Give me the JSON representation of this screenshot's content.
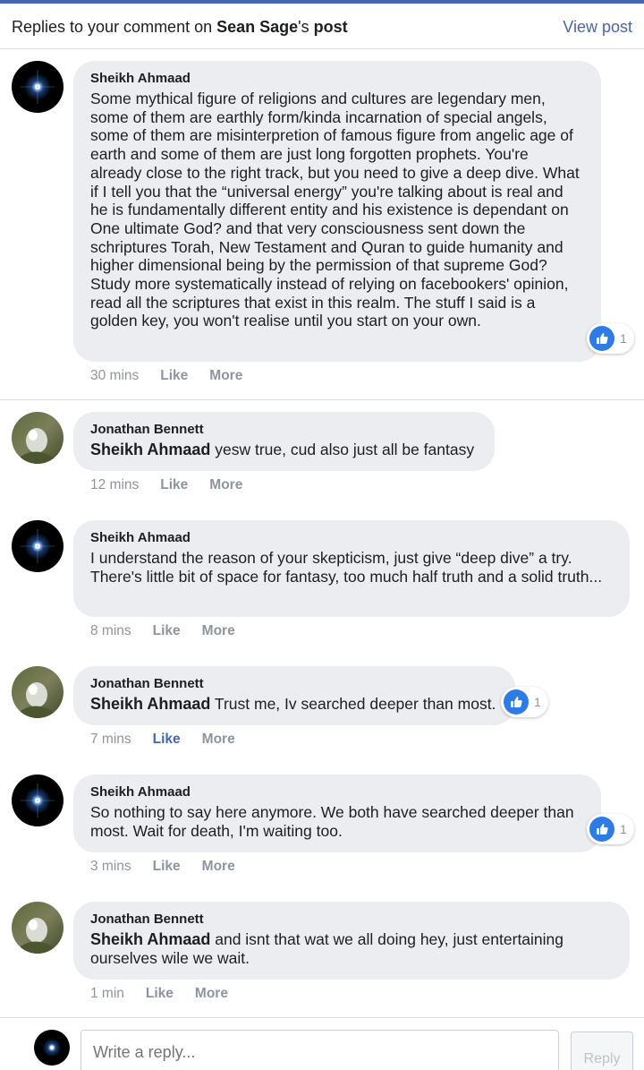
{
  "header": {
    "prefix": "Replies to your comment on ",
    "author": "Sean Sage",
    "suffix": "'s ",
    "post_word": "post",
    "view_post": "View post"
  },
  "comments": [
    {
      "author": "Sheikh Ahmaad",
      "mention": "",
      "text": "Some mythical figure of religions and cultures are legendary men, some of them are earthly form/kinda incarnation of special angels, some of them are misinterpretion of famous figure from angelic age of earth and some of them are just long forgotten prophets. You're already close to the right track, but you need to give a deep dive. What if I tell you that the “universal energy” you're talking about is real and he is fundamentally different entity and his existence is dependant on One ultimate God? and that very consciousness sent down the schriptures Torah, New Testament and Quran to guide humanity and higher dimensional being by the permission of that supreme God? Study more systematically instead of relying on facebookers' opinion, read all the scriptures that exist in this realm. The stuff I said is a golden key, you won't realise until you start on your own.",
      "time": "30 mins",
      "like": "Like",
      "more": "More",
      "reactions": "1"
    },
    {
      "author": "Jonathan Bennett",
      "mention": "Sheikh Ahmaad",
      "text": " yesw true, cud also just all be fantasy",
      "time": "12 mins",
      "like": "Like",
      "more": "More"
    },
    {
      "author": "Sheikh Ahmaad",
      "mention": "",
      "text": "I understand the reason of your skepticism, just give “deep dive” a try. There's little bit of space for fantasy, too much half truth and a solid truth...",
      "time": "8 mins",
      "like": "Like",
      "more": "More"
    },
    {
      "author": "Jonathan Bennett",
      "mention": "Sheikh Ahmaad",
      "text": " Trust me, Iv searched deeper than most.",
      "time": "7 mins",
      "like": "Like",
      "more": "More",
      "reactions": "1",
      "liked_by_me": true
    },
    {
      "author": "Sheikh Ahmaad",
      "mention": "",
      "text": "So nothing to say here anymore. We both have searched deeper than most. Wait for death, I'm waiting too.",
      "time": "3 mins",
      "like": "Like",
      "more": "More",
      "reactions": "1"
    },
    {
      "author": "Jonathan Bennett",
      "mention": "Sheikh Ahmaad",
      "text": " and isnt that wat we all doing hey, just entertaining ourselves wile we wait.",
      "time": "1 min",
      "like": "Like",
      "more": "More"
    }
  ],
  "composer": {
    "placeholder": "Write a reply...",
    "reply_label": "Reply"
  },
  "colors": {
    "accent": "#4267b2",
    "link": "#4b66a0",
    "bubble": "#ebedf0",
    "like_blue": "#2d7be5",
    "muted": "#90949c"
  }
}
